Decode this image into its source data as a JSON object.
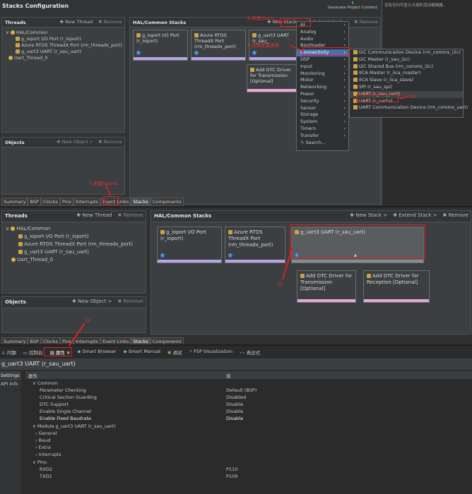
{
  "top": {
    "title": "Stacks Configuration",
    "generate": "Generate Project Content",
    "right_note": "没有任何可显示大纲的活动编辑器。",
    "threads": {
      "header": "Threads",
      "new_thread": "New Thread",
      "remove": "Remove",
      "tree": [
        "HAL/Common",
        "g_ioport I/O Port (r_ioport)",
        "Azure RTOS ThreadX Port (rm_threadx_port)",
        "g_uart3 UART (r_sau_uart)",
        "Uart_Thread_0"
      ]
    },
    "objects": {
      "header": "Objects",
      "new_object": "New Object »",
      "remove": "Remove"
    },
    "stacks": {
      "header": "HAL/Common Stacks",
      "new_stack": "New Stack >",
      "extend_stack": "Extend Stack >",
      "remove": "Remove"
    },
    "cards": {
      "ioport": "g_ioport I/O Port (r_ioport)",
      "threadx": "Azure RTOS ThreadX Port (rm_threadx_port)",
      "uart": "g_uart3 UART (r_sau_",
      "dtc": "Add DTC Driver for Transmission [Optional]"
    },
    "tabs": [
      "Summary",
      "BSP",
      "Clocks",
      "Pins",
      "Interrupts",
      "Event Links",
      "Stacks",
      "Components"
    ],
    "annot8": "8.新建Stack",
    "annot9": "9.选择配置连接",
    "annot10": "10",
    "annot7": "7.新建Stacks",
    "menu1": [
      "AI",
      "Analog",
      "Audio",
      "Bootloader",
      "Connectivity",
      "DSP",
      "Input",
      "Monitoring",
      "Motor",
      "Networking",
      "Power",
      "Security",
      "Sensor",
      "Storage",
      "System",
      "Timers",
      "Transfer",
      "Search..."
    ],
    "menu2": [
      "I2C Communication Device (rm_comms_i2c)",
      "I2C Master (r_sau_i2c)",
      "I2C Shared Bus (rm_comms_i2c)",
      "IICA Master (r_iica_master)",
      "IICA Slave (r_iica_slave)",
      "SPI (r_sau_spi)",
      "UART (r_sau_uart)",
      "UART (r_uarta)",
      "UART Communication Device (rm_comms_uart)"
    ]
  },
  "mid": {
    "threads": {
      "header": "Threads",
      "new_thread": "New Thread",
      "remove": "Remove",
      "tree": [
        "HAL/Common",
        "g_ioport I/O Port (r_ioport)",
        "Azure RTOS ThreadX Port (rm_threadx_port)",
        "g_uart3 UART (r_sau_uart)",
        "Uart_Thread_0"
      ]
    },
    "objects": {
      "header": "Objects",
      "new_object": "New Object >",
      "remove": "Remove"
    },
    "stacks": {
      "header": "HAL/Common Stacks",
      "new_stack": "New Stack >",
      "extend_stack": "Extend Stack >",
      "remove": "Remove"
    },
    "cards": {
      "ioport": "g_ioport I/O Port (r_ioport)",
      "threadx": "Azure RTOS ThreadX Port (rm_threadx_port)",
      "uart": "g_uart3 UART (r_sau_uart)",
      "dtc_tx": "Add DTC Driver for Transmission [Optional]",
      "dtc_rx": "Add DTC Driver for Reception [Optional]"
    },
    "annot11": "11",
    "tabs": [
      "Summary",
      "BSP",
      "Clocks",
      "Pins",
      "Interrupts",
      "Event Links",
      "Stacks",
      "Components"
    ]
  },
  "bottom": {
    "annot12": "12",
    "views": [
      "问题",
      "控制台",
      "属性",
      "Smart Browser",
      "Smart Manual",
      "调试",
      "FSP Visualization",
      "表达式"
    ],
    "title": "g_uart3 UART (r_sau_uart)",
    "side": [
      "Settings",
      "API Info"
    ],
    "col_prop": "属性",
    "col_val": "值",
    "rows": [
      {
        "k": "∨ Common",
        "v": ""
      },
      {
        "k": "Parameter Checking",
        "v": "Default (BSP)"
      },
      {
        "k": "Critical Section Guarding",
        "v": "Disabled"
      },
      {
        "k": "DTC Support",
        "v": "Disable"
      },
      {
        "k": "Enable Single Channel",
        "v": "Disable"
      },
      {
        "k": "Enable Fixed Baudrate",
        "v": "Disable"
      },
      {
        "k": "∨ Module g_uart3 UART (r_sau_uart)",
        "v": ""
      },
      {
        "k": "› General",
        "v": ""
      },
      {
        "k": "› Baud",
        "v": ""
      },
      {
        "k": "› Extra",
        "v": ""
      },
      {
        "k": "› Interrupts",
        "v": ""
      },
      {
        "k": "∨ Pins",
        "v": ""
      },
      {
        "k": "RXD2",
        "v": "P110"
      },
      {
        "k": "TXD2",
        "v": "P109"
      }
    ]
  }
}
